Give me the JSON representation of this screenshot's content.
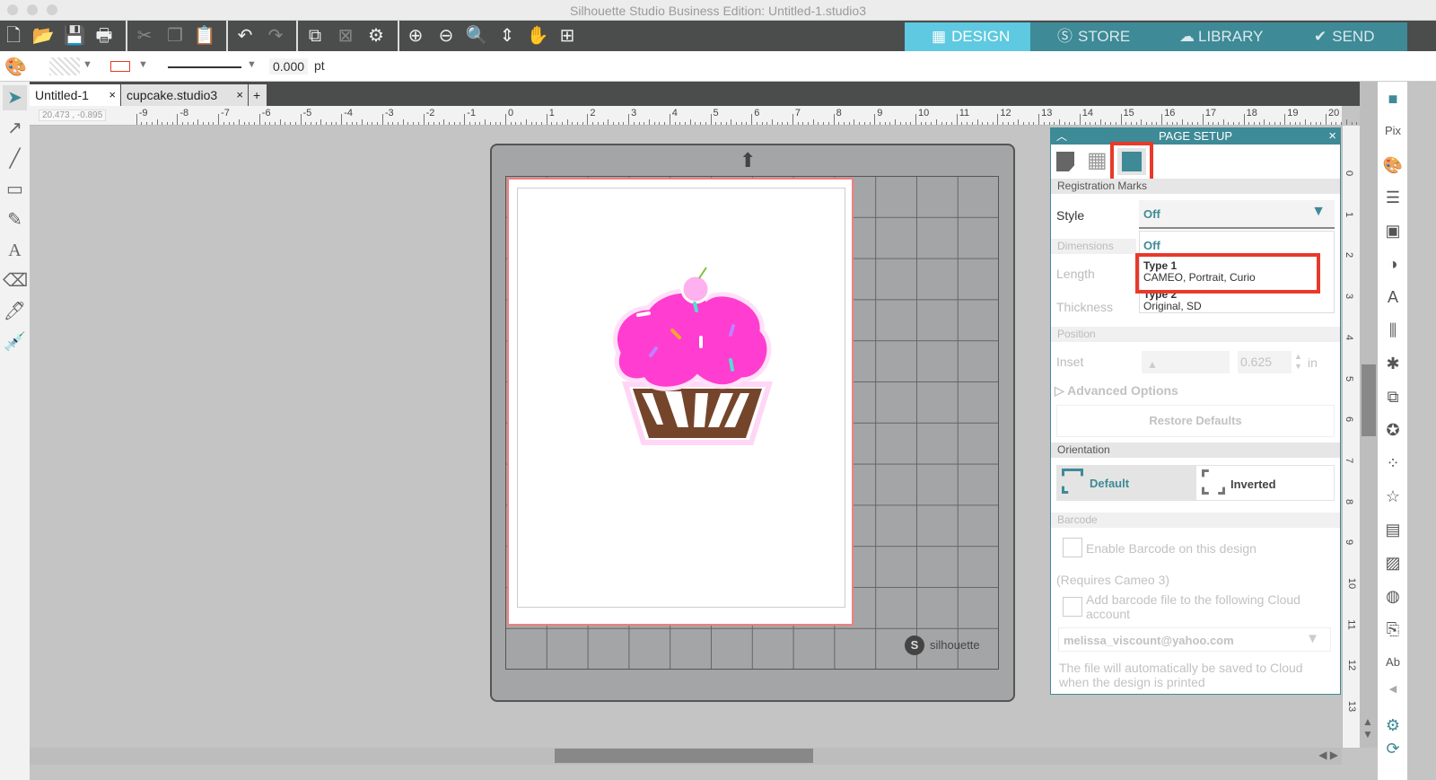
{
  "window": {
    "title": "Silhouette Studio Business Edition: Untitled-1.studio3"
  },
  "toolbar": {
    "icons": [
      "new-file-icon",
      "open-folder-icon",
      "save-icon",
      "print-icon",
      "cut-icon",
      "copy-icon",
      "paste-icon",
      "undo-icon",
      "redo-icon",
      "group-icon",
      "ungroup-icon",
      "release-compound-icon",
      "zoom-in-icon",
      "zoom-out-icon",
      "zoom-select-icon",
      "pan-down-icon",
      "hand-icon",
      "fit-page-icon"
    ]
  },
  "nav": [
    {
      "label": "DESIGN",
      "icon": "grid-icon",
      "active": true
    },
    {
      "label": "STORE",
      "icon": "silhouette-s-icon"
    },
    {
      "label": "LIBRARY",
      "icon": "cloud-download-icon"
    },
    {
      "label": "SEND",
      "icon": "check-circle-icon"
    }
  ],
  "line_options": {
    "stroke_width": "0.000",
    "unit": "pt",
    "line_color": "#e8392a"
  },
  "tabs": [
    {
      "label": "Untitled-1",
      "active": true
    },
    {
      "label": "cupcake.studio3"
    }
  ],
  "tab_add": "+",
  "tab_close": "×",
  "coordinates": "20.473 , -0.895",
  "ruler": {
    "h": [
      "-9",
      "-8",
      "-7",
      "-6",
      "-5",
      "-4",
      "-3",
      "-2",
      "-1",
      "0",
      "1",
      "2",
      "3",
      "4",
      "5",
      "6",
      "7",
      "8",
      "9",
      "10",
      "11",
      "12",
      "13",
      "14",
      "15",
      "16",
      "17",
      "18",
      "19",
      "20"
    ],
    "v": [
      "0",
      "1",
      "2",
      "3",
      "4",
      "5",
      "6",
      "7",
      "8",
      "9",
      "10",
      "11",
      "12",
      "13"
    ]
  },
  "mat": {
    "brand": "silhouette"
  },
  "panel": {
    "title": "PAGE SETUP",
    "close": "×",
    "section_registration": "Registration Marks",
    "style_label": "Style",
    "style_value": "Off",
    "dropdown_options": [
      {
        "title": "Off"
      },
      {
        "title": "Type 1",
        "subtitle": "CAMEO, Portrait, Curio"
      },
      {
        "title": "Type 2",
        "subtitle": "Original, SD"
      }
    ],
    "section_dimensions": "Dimensions",
    "length_label": "Length",
    "thickness_label": "Thickness",
    "section_position": "Position",
    "inset_label": "Inset",
    "inset_value": "0.625",
    "inset_unit": "in",
    "advanced": "Advanced Options",
    "restore": "Restore Defaults",
    "section_orientation": "Orientation",
    "orient_default": "Default",
    "orient_inverted": "Inverted",
    "section_barcode": "Barcode",
    "enable_barcode": "Enable Barcode on this design",
    "requires": "(Requires Cameo 3)",
    "add_barcode": "Add barcode file to the following Cloud account",
    "account": "melissa_viscount@yahoo.com",
    "note": "The file will automatically be saved to Cloud when the design is printed"
  },
  "colors": {
    "accent": "#3e8a97",
    "design_tab": "#5ec9e0",
    "highlight": "#e8392a",
    "frosting": "#ff3dd0",
    "wrapper": "#74452b"
  }
}
